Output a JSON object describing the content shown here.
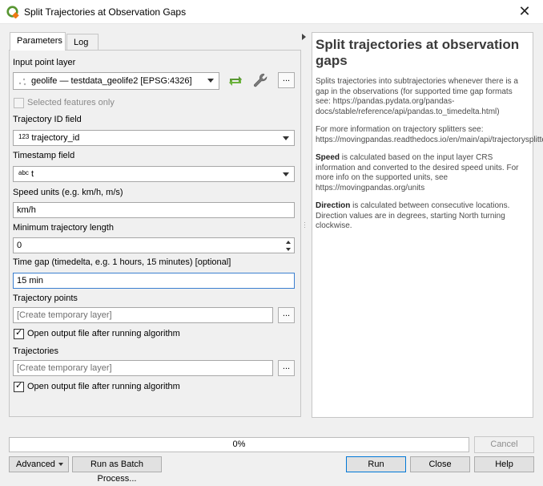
{
  "window": {
    "title": "Split Trajectories at Observation Gaps",
    "app_icon": "qgis-logo-icon",
    "close_glyph": "✕"
  },
  "tabs": [
    {
      "label": "Parameters",
      "active": true
    },
    {
      "label": "Log",
      "active": false
    }
  ],
  "params": {
    "input_layer": {
      "label": "Input point layer",
      "value": "geolife — testdata_geolife2 [EPSG:4326]",
      "icon": "point-layer-icon"
    },
    "selected_only": {
      "label": "Selected features only",
      "checked": false,
      "enabled": false
    },
    "traj_id": {
      "label": "Trajectory ID field",
      "type_badge": "123",
      "value": "trajectory_id"
    },
    "timestamp": {
      "label": "Timestamp field",
      "type_badge": "abc",
      "value": "t"
    },
    "speed_units": {
      "label": "Speed units (e.g. km/h, m/s)",
      "value": "km/h"
    },
    "min_length": {
      "label": "Minimum trajectory length",
      "value": "0"
    },
    "time_gap": {
      "label": "Time gap (timedelta, e.g. 1 hours, 15 minutes) [optional]",
      "value": "15 min"
    },
    "traj_points": {
      "label": "Trajectory points",
      "placeholder": "[Create temporary layer]",
      "open_after": "Open output file after running algorithm",
      "open_checked": true
    },
    "trajectories": {
      "label": "Trajectories",
      "placeholder": "[Create temporary layer]",
      "open_after": "Open output file after running algorithm",
      "open_checked": true
    },
    "dots": "...",
    "tick": "✓"
  },
  "help": {
    "title": "Split trajectories at observation gaps",
    "p1": "Splits trajectories into subtrajectories whenever there is a gap in the observations (for supported time gap formats see: https://pandas.pydata.org/pandas-docs/stable/reference/api/pandas.to_timedelta.html)",
    "p2": "For more information on trajectory splitters see: https://movingpandas.readthedocs.io/en/main/api/trajectorysplitter.html",
    "speed_bold": "Speed",
    "speed_rest": " is calculated based on the input layer CRS information and converted to the desired speed units. For more info on the supported units, see https://movingpandas.org/units",
    "direction_bold": "Direction",
    "direction_rest": " is calculated between consecutive locations. Direction values are in degrees, starting North turning clockwise."
  },
  "progress": {
    "text": "0%",
    "value": 0
  },
  "buttons": {
    "cancel": "Cancel",
    "advanced": "Advanced",
    "batch": "Run as Batch Process...",
    "run": "Run",
    "close": "Close",
    "help": "Help"
  },
  "colors": {
    "accent": "#0078d7",
    "qgis_green": "#589632",
    "qgis_yellow": "#ee7913"
  }
}
